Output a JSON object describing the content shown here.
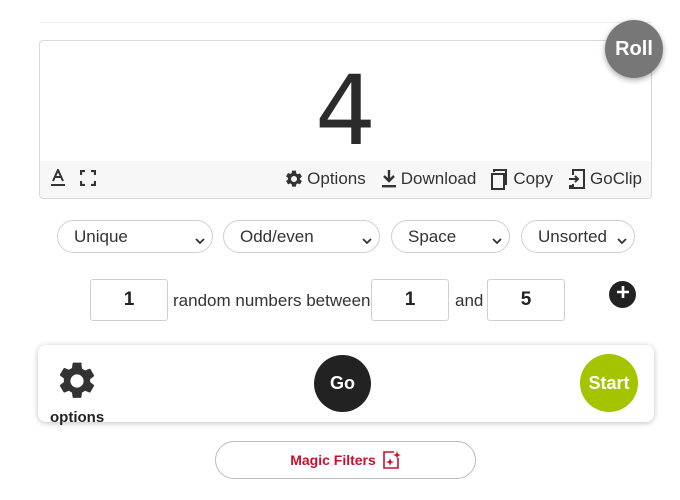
{
  "result": {
    "value": "4"
  },
  "roll_button": {
    "label": "Roll"
  },
  "toolbar": {
    "options_label": "Options",
    "download_label": "Download",
    "copy_label": "Copy",
    "goclip_label": "GoClip"
  },
  "filters": {
    "unique": "Unique",
    "odd_even": "Odd/even",
    "space": "Space",
    "sort": "Unsorted"
  },
  "generator": {
    "count": "1",
    "text_mid": "random numbers between",
    "min": "1",
    "text_and": "and",
    "max": "5"
  },
  "action_bar": {
    "options_label": "options",
    "go_label": "Go",
    "start_label": "Start"
  },
  "magic_filters": {
    "label": "Magic Filters"
  },
  "colors": {
    "start": "#a4c400",
    "go": "#222222",
    "roll": "#777777",
    "magic_text": "#c8102e"
  }
}
